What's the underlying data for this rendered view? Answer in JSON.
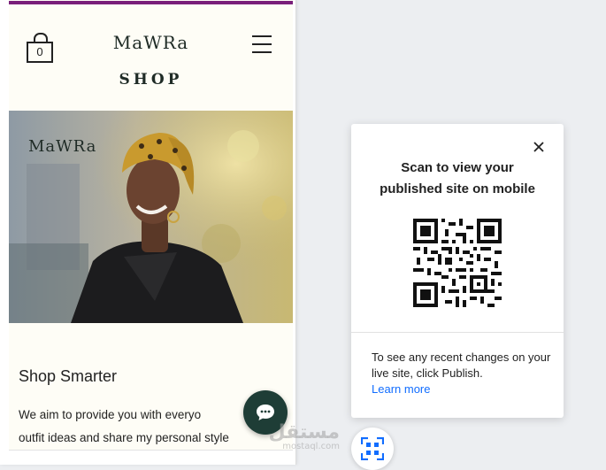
{
  "site": {
    "cart_count": "0",
    "brand": "MaWRa",
    "shop_label": "SHOP",
    "hero_brand": "MaWRa",
    "headline": "Shop Smarter",
    "body_line1": "We aim to provide you with everyo",
    "body_line2": "outfit ideas and share my personal style"
  },
  "popup": {
    "title_line1": "Scan to view your",
    "title_line2": "published site on mobile",
    "note": "To see any recent changes on your live site, click Publish.",
    "link": "Learn more"
  },
  "watermark": {
    "arabic": "مستقل",
    "domain": "mostaql.com"
  },
  "colors": {
    "accent_bar": "#7a1f7a",
    "chat_button": "#1e3d36",
    "link": "#116dff"
  },
  "icons": {
    "cart": "shopping-bag-icon",
    "menu": "hamburger-menu-icon",
    "chat": "chat-bubble-icon",
    "close": "close-icon",
    "qr": "qr-code-icon"
  }
}
